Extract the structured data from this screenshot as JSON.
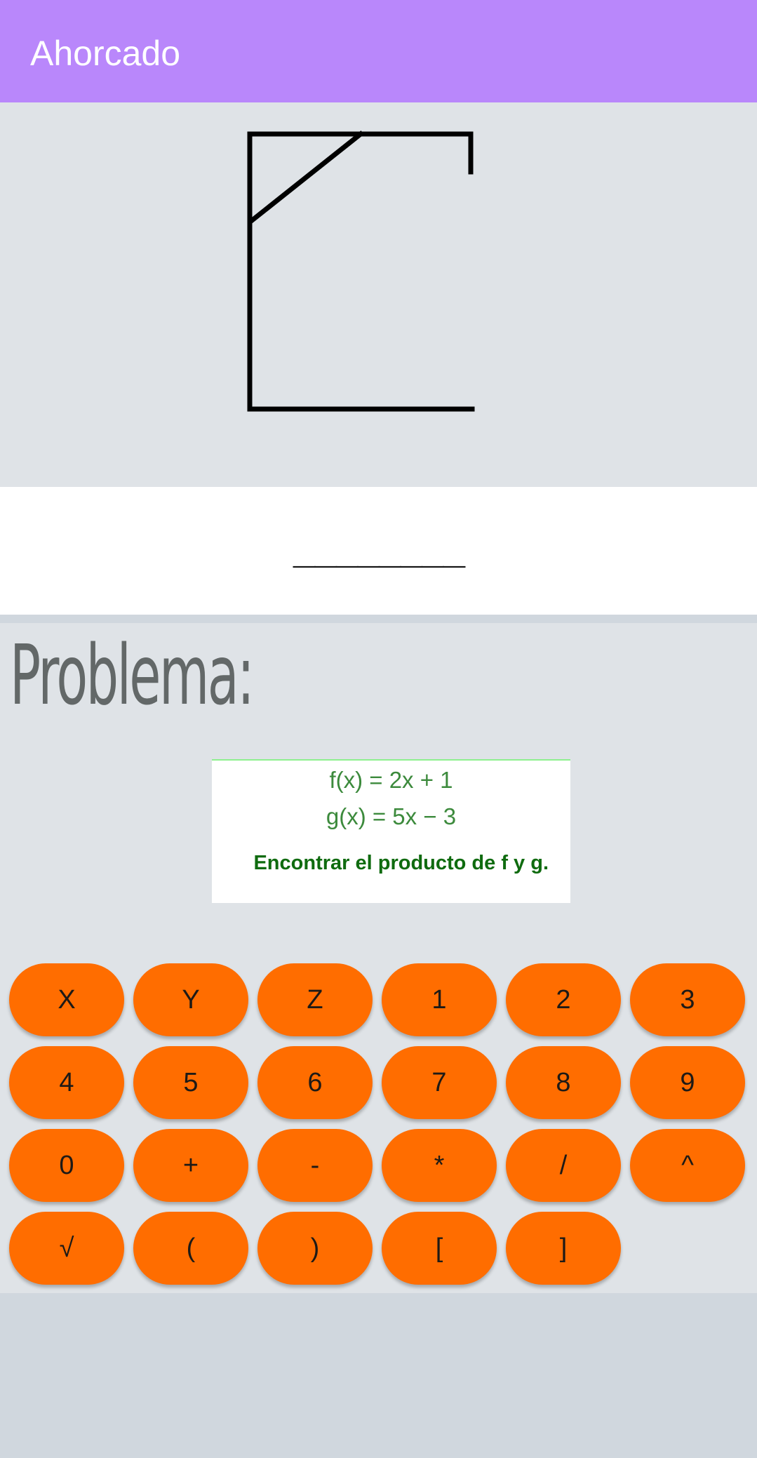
{
  "app_bar": {
    "title": "Ahorcado",
    "color": "#b987fb"
  },
  "gallows": {
    "stage": 1,
    "stroke_color": "#000000"
  },
  "word": {
    "display": "________"
  },
  "problem": {
    "heading": "Problema:",
    "formula_f": "f(x) = 2x + 1",
    "formula_g": "g(x) = 5x − 3",
    "instruction": "Encontrar el producto de f y g."
  },
  "keypad": {
    "button_color": "#ff6d00",
    "keys": [
      [
        "X",
        "Y",
        "Z",
        "1",
        "2",
        "3"
      ],
      [
        "4",
        "5",
        "6",
        "7",
        "8",
        "9"
      ],
      [
        "0",
        "+",
        "-",
        "*",
        "/",
        "^"
      ],
      [
        "√",
        "(",
        ")",
        "[",
        "]"
      ]
    ]
  }
}
